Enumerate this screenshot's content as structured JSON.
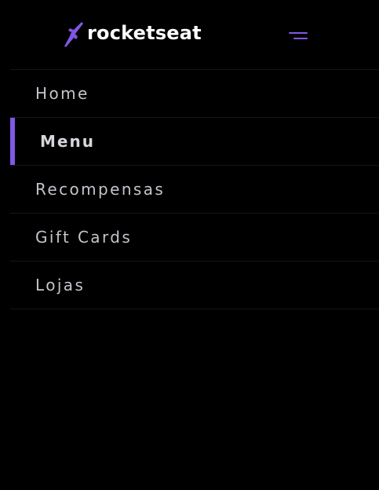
{
  "brand": {
    "name": "rocketseat",
    "accent_color": "#8257e5"
  },
  "header": {
    "menu_toggle_icon": "menu-icon"
  },
  "nav": {
    "items": [
      {
        "label": "Home",
        "active": false
      },
      {
        "label": "Menu",
        "active": true
      },
      {
        "label": "Recompensas",
        "active": false
      },
      {
        "label": "Gift Cards",
        "active": false
      },
      {
        "label": "Lojas",
        "active": false
      }
    ]
  }
}
